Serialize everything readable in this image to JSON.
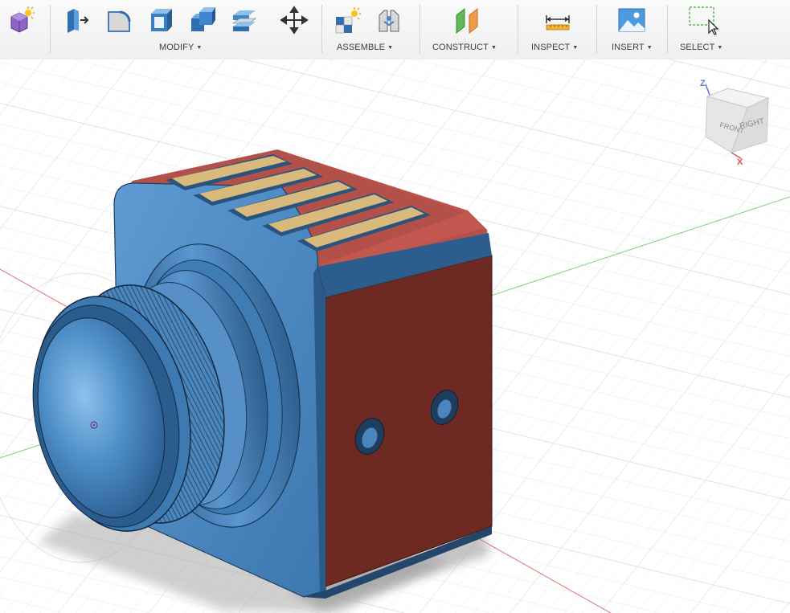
{
  "toolbar": {
    "groups": [
      {
        "label": "MODIFY"
      },
      {
        "label": "ASSEMBLE"
      },
      {
        "label": "CONSTRUCT"
      },
      {
        "label": "INSPECT"
      },
      {
        "label": "INSERT"
      },
      {
        "label": "SELECT"
      }
    ],
    "tools": [
      {
        "icon": "new-component-icon"
      },
      {
        "icon": "press-pull-icon"
      },
      {
        "icon": "fillet-icon"
      },
      {
        "icon": "shell-icon"
      },
      {
        "icon": "combine-icon"
      },
      {
        "icon": "split-body-icon"
      },
      {
        "icon": "move-icon"
      },
      {
        "icon": "new-component-assemble-icon"
      },
      {
        "icon": "joint-icon"
      },
      {
        "icon": "offset-plane-icon"
      },
      {
        "icon": "measure-icon"
      },
      {
        "icon": "insert-image-icon"
      },
      {
        "icon": "window-select-icon"
      }
    ]
  },
  "viewcube": {
    "face_front": "FRONT",
    "face_right": "RIGHT",
    "axis_z": "Z",
    "axis_x": "X"
  },
  "colors": {
    "body_blue": "#4a8cc7",
    "face_red": "#7a2a24",
    "vent_gold": "#d8b878",
    "axis_red": "#e05050",
    "axis_green": "#5cc45c"
  }
}
